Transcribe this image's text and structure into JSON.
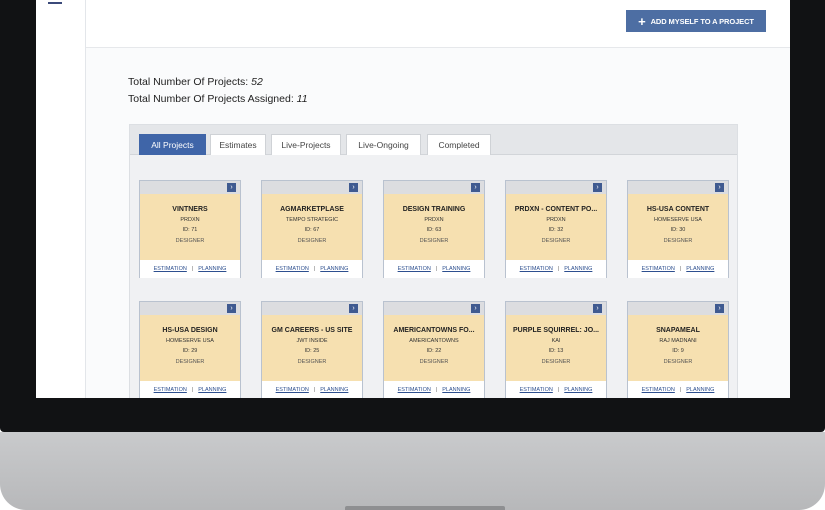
{
  "header": {
    "add_button_label": "ADD MYSELF TO A PROJECT",
    "add_button_icon": "plus-icon"
  },
  "sidebar": {
    "menu_icon": "menu-icon"
  },
  "stats": {
    "total_projects_label": "Total Number Of Projects:",
    "total_projects_value": "52",
    "assigned_label": "Total Number Of Projects Assigned:",
    "assigned_value": "11"
  },
  "tabs": [
    {
      "label": "All Projects",
      "active": true
    },
    {
      "label": "Estimates",
      "active": false
    },
    {
      "label": "Live-Projects",
      "active": false
    },
    {
      "label": "Live-Ongoing",
      "active": false
    },
    {
      "label": "Completed",
      "active": false
    }
  ],
  "card_links": {
    "estimation": "ESTIMATION",
    "separator": "|",
    "planning": "PLANNING"
  },
  "cards": [
    {
      "title": "VINTNERS",
      "client": "PRDXN",
      "id": "ID: 71",
      "role": "DESIGNER"
    },
    {
      "title": "AGMARKETPLASE",
      "client": "TEMPO STRATEGIC",
      "id": "ID: 67",
      "role": "DESIGNER"
    },
    {
      "title": "DESIGN TRAINING",
      "client": "PRDXN",
      "id": "ID: 63",
      "role": "DESIGNER"
    },
    {
      "title": "PRDXN - CONTENT PO...",
      "client": "PRDXN",
      "id": "ID: 32",
      "role": "DESIGNER"
    },
    {
      "title": "HS-USA CONTENT",
      "client": "HOMESERVE USA",
      "id": "ID: 30",
      "role": "DESIGNER"
    },
    {
      "title": "HS-USA DESIGN",
      "client": "HOMESERVE USA",
      "id": "ID: 29",
      "role": "DESIGNER"
    },
    {
      "title": "GM CAREERS - US SITE",
      "client": "JWT INSIDE",
      "id": "ID: 25",
      "role": "DESIGNER"
    },
    {
      "title": "AMERICANTOWNS FO...",
      "client": "AMERICANTOWNS",
      "id": "ID: 22",
      "role": "DESIGNER"
    },
    {
      "title": "PURPLE SQUIRREL: JO...",
      "client": "KAI",
      "id": "ID: 13",
      "role": "DESIGNER"
    },
    {
      "title": "SNAPAMEAL",
      "client": "RAJ MADNANI",
      "id": "ID: 9",
      "role": "DESIGNER"
    }
  ],
  "colors": {
    "accent": "#3f65a8",
    "button": "#4d6ea3",
    "card_body": "#f6e0b0",
    "bezel": "#111214"
  }
}
